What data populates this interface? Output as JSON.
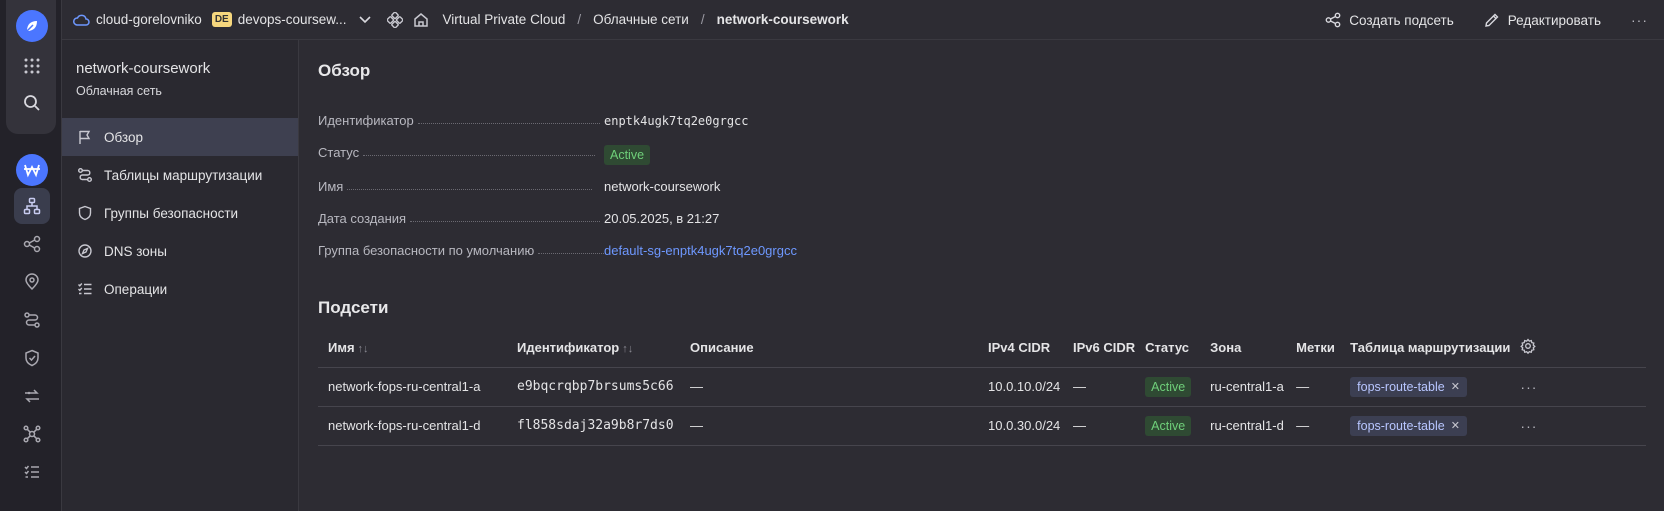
{
  "rail": {
    "icons": [
      "logo-icon",
      "apps-grid-icon",
      "search-icon",
      "cloud-badge-icon",
      "network-icon",
      "share-icon",
      "location-icon",
      "route-icon",
      "shield-icon",
      "transfer-icon",
      "hub-icon",
      "list-icon"
    ],
    "cloud_badge": "ш"
  },
  "topbar": {
    "cloud": "cloud-gorelovniko",
    "folder_badge": "DE",
    "folder": "devops-coursew...",
    "crumbs": [
      "Virtual Private Cloud",
      "Облачные сети",
      "network-coursework"
    ],
    "actions": {
      "create_subnet": "Создать подсеть",
      "edit": "Редактировать",
      "more": "···"
    }
  },
  "subnav": {
    "title": "network-coursework",
    "subtitle": "Облачная сеть",
    "items": [
      {
        "label": "Обзор",
        "icon": "flag-icon",
        "active": true
      },
      {
        "label": "Таблицы маршрутизации",
        "icon": "route-icon"
      },
      {
        "label": "Группы безопасности",
        "icon": "shield-icon"
      },
      {
        "label": "DNS зоны",
        "icon": "compass-icon"
      },
      {
        "label": "Операции",
        "icon": "list-icon"
      }
    ]
  },
  "overview": {
    "heading": "Обзор",
    "props": [
      {
        "label": "Идентификатор",
        "value": "enptk4ugk7tq2e0grgcc"
      },
      {
        "label": "Статус",
        "value": "Active"
      },
      {
        "label": "Имя",
        "value": "network-coursework"
      },
      {
        "label": "Дата создания",
        "value": "20.05.2025, в 21:27"
      },
      {
        "label": "Группа безопасности по умолчанию",
        "value": "default-sg-enptk4ugk7tq2e0grgcc"
      }
    ]
  },
  "subnets": {
    "heading": "Подсети",
    "columns": [
      "Имя",
      "Идентификатор",
      "Описание",
      "IPv4 CIDR",
      "IPv6 CIDR",
      "Статус",
      "Зона",
      "Метки",
      "Таблица маршрутизации"
    ],
    "sort_glyph": "↑↓",
    "rows": [
      {
        "name": "network-fops-ru-central1-a",
        "id": "e9bqcrqbp7brsums5c66",
        "description": "—",
        "ipv4": "10.0.10.0/24",
        "ipv6": "—",
        "status": "Active",
        "zone": "ru-central1-a",
        "labels": "—",
        "route_table": "fops-route-table",
        "more": "···"
      },
      {
        "name": "network-fops-ru-central1-d",
        "id": "fl858sdaj32a9b8r7ds0",
        "description": "—",
        "ipv4": "10.0.30.0/24",
        "ipv6": "—",
        "status": "Active",
        "zone": "ru-central1-d",
        "labels": "—",
        "route_table": "fops-route-table",
        "more": "···"
      }
    ]
  },
  "colors": {
    "accent": "#4b76ff",
    "link": "#6e98ff",
    "status_active_bg": "#2f4a33",
    "status_active_text": "#6fcf7a"
  }
}
